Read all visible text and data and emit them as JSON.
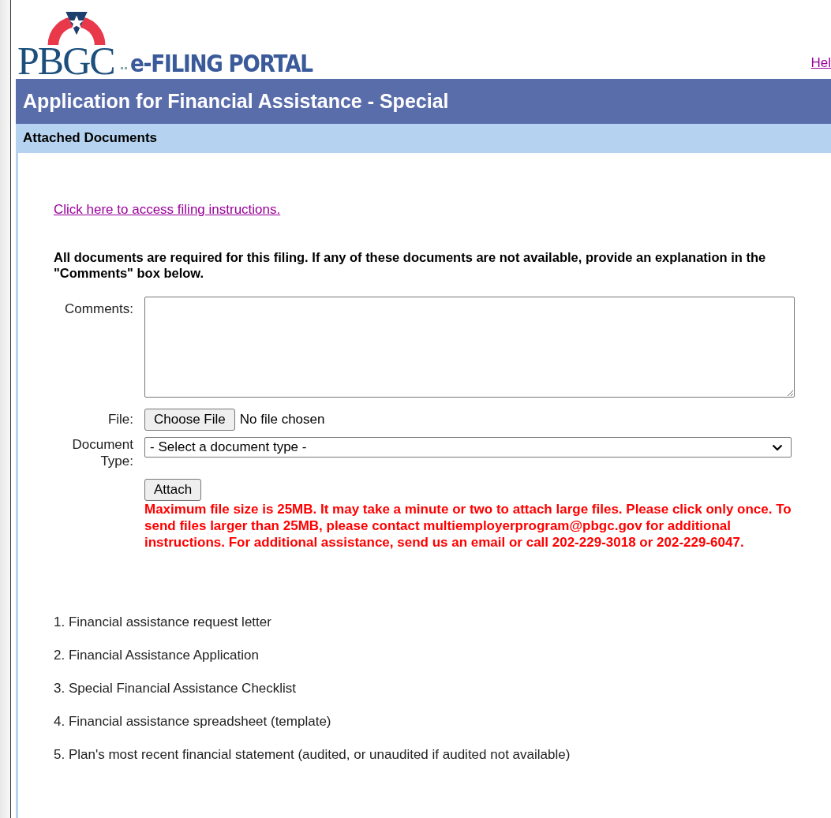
{
  "header": {
    "logo_letters": "PBGC",
    "portal_title": "e-FILING PORTAL",
    "help_link": "Hel"
  },
  "title_bar": {
    "title": "Application for Financial Assistance - Special"
  },
  "section_bar": {
    "title": "Attached Documents"
  },
  "instructions_link": "Click here to access filing instructions.",
  "notice": "All documents are required for this filing. If any of these documents are not available, provide an explanation in the \"Comments\" box below.",
  "form": {
    "comments_label": "Comments:",
    "file_label": "File:",
    "file_button": "Choose File",
    "file_status": "No file chosen",
    "doctype_label": "Document Type:",
    "doctype_value": "- Select a document type -",
    "attach_button": "Attach"
  },
  "warning": "Maximum file size is 25MB. It may take a minute or two to attach large files. Please click only once. To send files larger than 25MB, please contact multiemployerprogram@pbgc.gov for additional instructions. For additional assistance, send us an email or call 202-229-3018 or 202-229-6047.",
  "documents": [
    {
      "text": "1. Financial assistance request letter"
    },
    {
      "text": "2. Financial Assistance Application"
    },
    {
      "text": "3. Special Financial Assistance Checklist"
    },
    {
      "text": "4. Financial assistance spreadsheet (template)"
    },
    {
      "text": "5. Plan's most recent financial statement (audited, or unaudited if audited not available)"
    }
  ]
}
